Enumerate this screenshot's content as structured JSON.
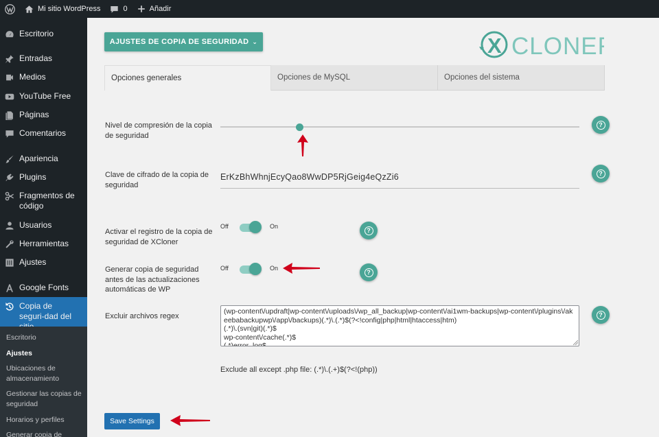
{
  "adminbar": {
    "site_name": "Mi sitio WordPress",
    "comments_count": "0",
    "new_label": "Añadir"
  },
  "sidebar": {
    "items": [
      {
        "label": "Escritorio",
        "icon": "dashboard-icon"
      },
      {
        "label": "Entradas",
        "icon": "pin-icon"
      },
      {
        "label": "Medios",
        "icon": "media-icon"
      },
      {
        "label": "YouTube Free",
        "icon": "youtube-icon"
      },
      {
        "label": "Páginas",
        "icon": "pages-icon"
      },
      {
        "label": "Comentarios",
        "icon": "comments-icon"
      },
      {
        "label": "Apariencia",
        "icon": "brush-icon"
      },
      {
        "label": "Plugins",
        "icon": "plugin-icon"
      },
      {
        "label": "Fragmentos de código",
        "icon": "scissors-icon"
      },
      {
        "label": "Usuarios",
        "icon": "users-icon"
      },
      {
        "label": "Herramientas",
        "icon": "wrench-icon"
      },
      {
        "label": "Ajustes",
        "icon": "settings-icon"
      },
      {
        "label": "Google Fonts",
        "icon": "font-icon"
      },
      {
        "label": "Copia de seguri-dad del sitio",
        "icon": "backup-icon"
      }
    ],
    "submenu": [
      {
        "label": "Escritorio"
      },
      {
        "label": "Ajustes"
      },
      {
        "label": "Ubicaciones de almacenamiento"
      },
      {
        "label": "Gestionar las copias de seguridad"
      },
      {
        "label": "Horarios y perfiles"
      },
      {
        "label": "Generar copia de"
      }
    ]
  },
  "header": {
    "dropdown_label": "AJUSTES DE COPIA DE SEGURIDAD",
    "logo_text": "CLONER",
    "logo_letter": "X"
  },
  "tabs": [
    {
      "label": "Opciones generales"
    },
    {
      "label": "Opciones de MySQL"
    },
    {
      "label": "Opciones del sistema"
    }
  ],
  "settings": {
    "compression": {
      "label": "Nivel de compresión de la copia de seguridad",
      "level": 0.22
    },
    "encryption": {
      "label": "Clave de cifrado de la copia de seguridad",
      "value": "ErKzBhWhnjEcyQao8WwDP5RjGeig4eQzZi6"
    },
    "logging": {
      "label": "Activar el registro de la copia de seguridad de XCloner",
      "off": "Off",
      "on": "On",
      "enabled": true
    },
    "auto_update_backup": {
      "label": "Generar copia de seguridad antes de las actualizaciones automáticas de WP",
      "off": "Off",
      "on": "On",
      "enabled": true
    },
    "exclude_regex": {
      "label": "Excluir archivos regex",
      "value": "(wp-content\\/updraft|wp-content\\/uploads\\/wp_all_backup|wp-content\\/ai1wm-backups|wp-content\\/plugins\\/akeebabackupwp\\/app\\/backups)(.*)\\.(.*)$(?<!config|php|html|htaccess|htm)\n(.*)\\.(svn|git)(.*)$\nwp-content\\/cache(.*)$\n(.*)error_log$",
      "hint": "Exclude all except .php file: (.*)\\.(.+)$(?<!(php))"
    },
    "help_label": "?"
  },
  "save_label": "Save Settings",
  "colors": {
    "accent": "#4aa596",
    "wp_blue": "#2271b1",
    "sidebar_bg": "#1d2327",
    "annotation_arrow": "#d0021b"
  }
}
